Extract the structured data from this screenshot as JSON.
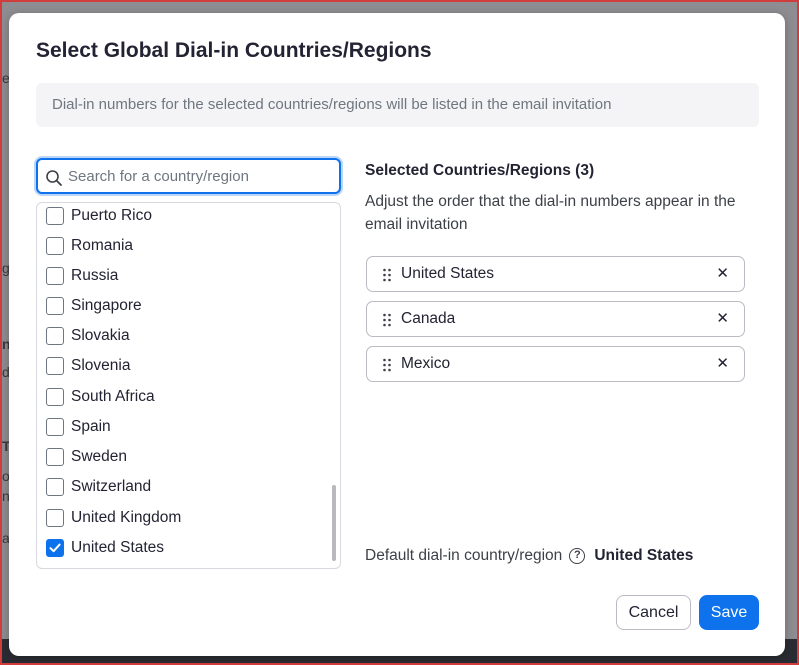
{
  "dialog": {
    "title": "Select Global Dial-in Countries/Regions",
    "info": "Dial-in numbers for the selected countries/regions will be listed in the email invitation"
  },
  "search": {
    "placeholder": "Search for a country/region",
    "value": ""
  },
  "country_list": {
    "items": [
      {
        "label": "Puerto Rico",
        "checked": false
      },
      {
        "label": "Romania",
        "checked": false
      },
      {
        "label": "Russia",
        "checked": false
      },
      {
        "label": "Singapore",
        "checked": false
      },
      {
        "label": "Slovakia",
        "checked": false
      },
      {
        "label": "Slovenia",
        "checked": false
      },
      {
        "label": "South Africa",
        "checked": false
      },
      {
        "label": "Spain",
        "checked": false
      },
      {
        "label": "Sweden",
        "checked": false
      },
      {
        "label": "Switzerland",
        "checked": false
      },
      {
        "label": "United Kingdom",
        "checked": false
      },
      {
        "label": "United States",
        "checked": true
      }
    ]
  },
  "selected": {
    "heading": "Selected Countries/Regions (3)",
    "description": "Adjust the order that the dial-in numbers appear in the email invitation",
    "items": [
      {
        "label": "United States"
      },
      {
        "label": "Canada"
      },
      {
        "label": "Mexico"
      }
    ],
    "remove_glyph": "✕"
  },
  "default_country": {
    "label": "Default dial-in country/region",
    "help_glyph": "?",
    "value": "United States"
  },
  "buttons": {
    "cancel": "Cancel",
    "save": "Save"
  },
  "background_glimpses": [
    "e",
    "g",
    "n",
    "d",
    "T",
    "o",
    "n",
    "a"
  ],
  "colors": {
    "accent": "#0e72ed",
    "frame": "#d23c3c",
    "overlay": "#8e8e92",
    "text": "#232333"
  }
}
